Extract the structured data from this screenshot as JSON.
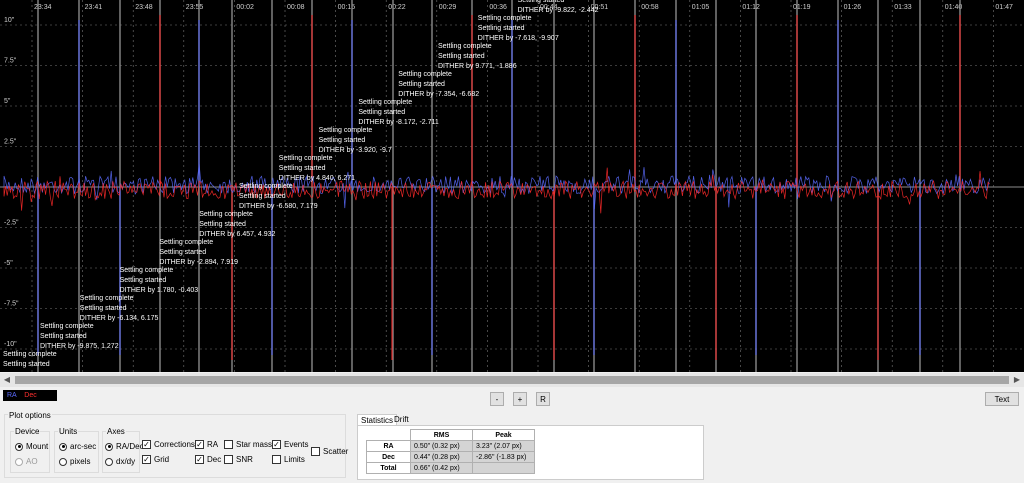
{
  "plot": {
    "time_ticks": [
      "23:34",
      "23:41",
      "23:48",
      "23:55",
      "00:02",
      "00:08",
      "00:15",
      "00:22",
      "00:29",
      "00:36",
      "00:44",
      "00:51",
      "00:58",
      "01:05",
      "01:12",
      "01:19",
      "01:26",
      "01:33",
      "01:40",
      "01:47"
    ],
    "y_ticks": [
      "10\"",
      "7.5\"",
      "5\"",
      "2.5\"",
      "-2.5\"",
      "-5\"",
      "-7.5\"",
      "-10\""
    ],
    "annotations": [
      {
        "lines": [
          "Settling complete",
          "Settling started"
        ]
      },
      {
        "lines": [
          "Settling complete",
          "Settling started",
          "DITHER by -9.875, 1.272"
        ]
      },
      {
        "lines": [
          "Settling complete",
          "Settling started",
          "DITHER by -6.134, 6.175"
        ]
      },
      {
        "lines": [
          "Settling complete",
          "Settling started",
          "DITHER by 1.780, -0.403"
        ]
      },
      {
        "lines": [
          "Settling complete",
          "Settling started",
          "DITHER by -2.894, 7.919"
        ]
      },
      {
        "lines": [
          "Settling complete",
          "Settling started",
          "DITHER by 6.457, 4.932"
        ]
      },
      {
        "lines": [
          "Settling complete",
          "Settling started",
          "DITHER by -6.580, 7.179"
        ]
      },
      {
        "lines": [
          "Settling complete",
          "Settling started",
          "DITHER by 4.840, 6.271"
        ]
      },
      {
        "lines": [
          "Settling complete",
          "Settling started",
          "DITHER by -3.920, -9.7"
        ]
      },
      {
        "lines": [
          "Settling complete",
          "Settling started",
          "DITHER by -8.172, -2.711"
        ]
      },
      {
        "lines": [
          "Settling complete",
          "Settling started",
          "DITHER by -7.354, -6.682"
        ]
      },
      {
        "lines": [
          "Settling complete",
          "Settling started",
          "DITHER by 9.771, -1.886"
        ]
      },
      {
        "lines": [
          "Settling complete",
          "Settling started",
          "DITHER by -7.618, -9.907"
        ]
      },
      {
        "lines": [
          "Settling complete",
          "Settling started",
          "DITHER by -9.822, -2.442"
        ]
      }
    ],
    "colors": {
      "ra": "#5b6bff",
      "dec": "#ff2a2a",
      "grid": "#777777",
      "background": "#000000"
    }
  },
  "scrollbar": {
    "left_arrow": "◀",
    "right_arrow": "▶"
  },
  "legend": {
    "ra_label": "RA",
    "dec_label": "Dec"
  },
  "zoom_controls": {
    "minus": "-",
    "plus": "+",
    "reset": "R"
  },
  "text_button": "Text",
  "plot_options": {
    "title": "Plot options",
    "device": {
      "title": "Device",
      "options": [
        "Mount",
        "AO"
      ],
      "selected": "Mount"
    },
    "units": {
      "title": "Units",
      "options": [
        "arc-sec",
        "pixels"
      ],
      "selected": "arc-sec"
    },
    "axes": {
      "title": "Axes",
      "options": [
        "RA/Dec",
        "dx/dy"
      ],
      "selected": "RA/Dec"
    },
    "checkboxes": {
      "corrections": {
        "label": "Corrections",
        "checked": true
      },
      "grid": {
        "label": "Grid",
        "checked": true
      },
      "ra": {
        "label": "RA",
        "checked": true
      },
      "dec": {
        "label": "Dec",
        "checked": true
      },
      "star_mass": {
        "label": "Star mass",
        "checked": false
      },
      "snr": {
        "label": "SNR",
        "checked": false
      },
      "events": {
        "label": "Events",
        "checked": true
      },
      "limits": {
        "label": "Limits",
        "checked": false
      },
      "scatter": {
        "label": "Scatter",
        "checked": false
      }
    }
  },
  "stats": {
    "tabs": [
      "Statistics",
      "Drift"
    ],
    "headers": [
      "RMS",
      "Peak"
    ],
    "rows": [
      {
        "label": "RA",
        "rms": "0.50\" (0.32 px)",
        "peak": "3.23\" (2.07 px)"
      },
      {
        "label": "Dec",
        "rms": "0.44\" (0.28 px)",
        "peak": "-2.86\" (-1.83 px)"
      },
      {
        "label": "Total",
        "rms": "0.66\" (0.42 px)",
        "peak": ""
      }
    ]
  }
}
